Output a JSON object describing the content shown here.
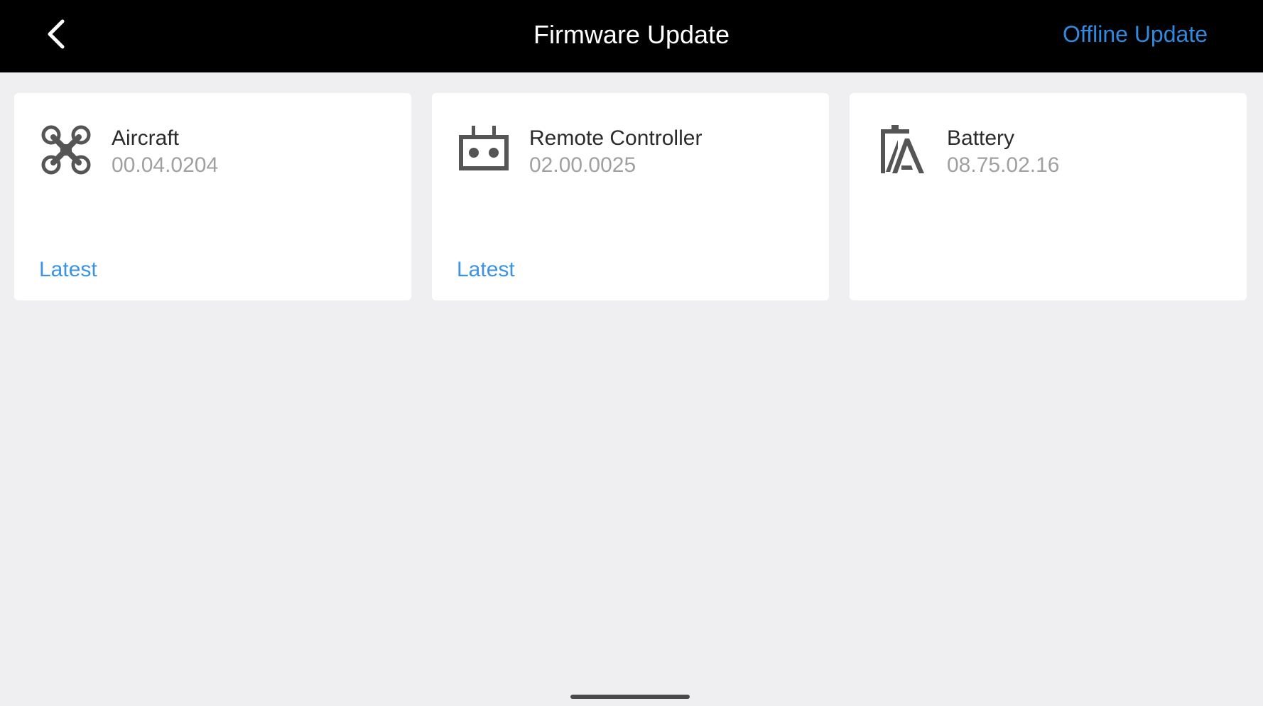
{
  "header": {
    "title": "Firmware Update",
    "offline_update_label": "Offline Update",
    "back_icon": "chevron-left-icon"
  },
  "devices": [
    {
      "name": "Aircraft",
      "version": "00.04.0204",
      "status": "Latest",
      "icon": "drone-icon"
    },
    {
      "name": "Remote Controller",
      "version": "02.00.0025",
      "status": "Latest",
      "icon": "remote-controller-icon"
    },
    {
      "name": "Battery",
      "version": "08.75.02.16",
      "status": "",
      "icon": "battery-icon"
    }
  ],
  "colors": {
    "header_bg": "#000000",
    "accent": "#2f8ae0",
    "page_bg": "#efeff1",
    "card_bg": "#ffffff",
    "secondary_text": "#a0a0a0"
  }
}
